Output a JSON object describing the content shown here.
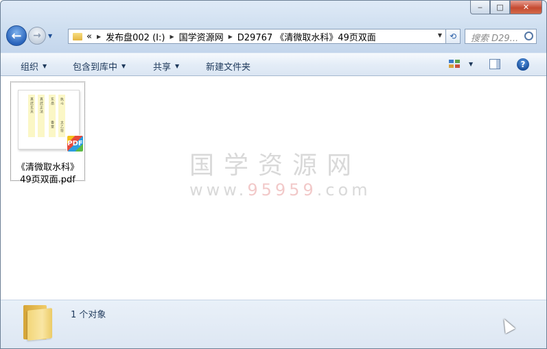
{
  "window": {
    "buttons": {
      "minimize": "‒",
      "maximize": "□",
      "close": "✕"
    }
  },
  "nav": {
    "back_icon": "←",
    "forward_icon": "→",
    "history_icon": "▼",
    "breadcrumb": [
      "«",
      "发布盘002 (I:)",
      "国学资源网",
      "D29767 《清微取水科》49页双面"
    ],
    "search_placeholder": "搜索 D29...",
    "refresh_icon": "⟲"
  },
  "toolbar": {
    "organize": "组织",
    "include_in_library": "包含到库中",
    "share": "共享",
    "new_folder": "新建文件夹",
    "help": "?"
  },
  "files": [
    {
      "name_line1": "《清微取水科》",
      "name_line2": "49页双面.pdf",
      "badge": "PDF",
      "thumb_cols": [
        "真武玄天",
        "真武正法",
        "东岳",
        "执斗",
        "香堂",
        "太乙符"
      ]
    }
  ],
  "watermark": {
    "line1": "国学资源网",
    "line2_a": "www.",
    "line2_b": "95959",
    "line2_c": ".com"
  },
  "status": {
    "count": "1 个对象"
  },
  "colors": {
    "title_band": "#dfeaf7",
    "command_text": "#1e395b",
    "close": "#c54a31"
  }
}
